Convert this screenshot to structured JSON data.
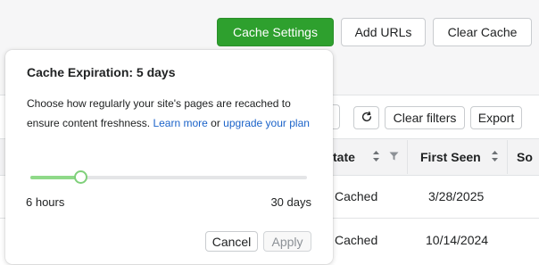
{
  "toolbar": {
    "cache_settings": "Cache Settings",
    "add_urls": "Add URLs",
    "clear_cache": "Clear Cache"
  },
  "table_tools": {
    "refresh_icon": "refresh-icon",
    "clear_filters": "Clear filters",
    "export": "Export"
  },
  "table": {
    "columns": [
      "tate",
      "First Seen",
      "So"
    ],
    "rows": [
      {
        "state": "Cached",
        "first_seen": "3/28/2025"
      },
      {
        "state": "Cached",
        "first_seen": "10/14/2024"
      }
    ]
  },
  "popover": {
    "title": "Cache Expiration: 5 days",
    "description_text": "Choose how regularly your site's pages are recached to ensure content freshness.",
    "learn_more": "Learn more",
    "or": "or",
    "upgrade": "upgrade your plan",
    "slider": {
      "min_label": "6 hours",
      "max_label": "30 days",
      "value_fraction": 0.18
    },
    "cancel": "Cancel",
    "apply": "Apply"
  },
  "colors": {
    "primary_button": "#2ea02e",
    "link": "#1b63c9",
    "slider_fill": "#8fd989"
  }
}
